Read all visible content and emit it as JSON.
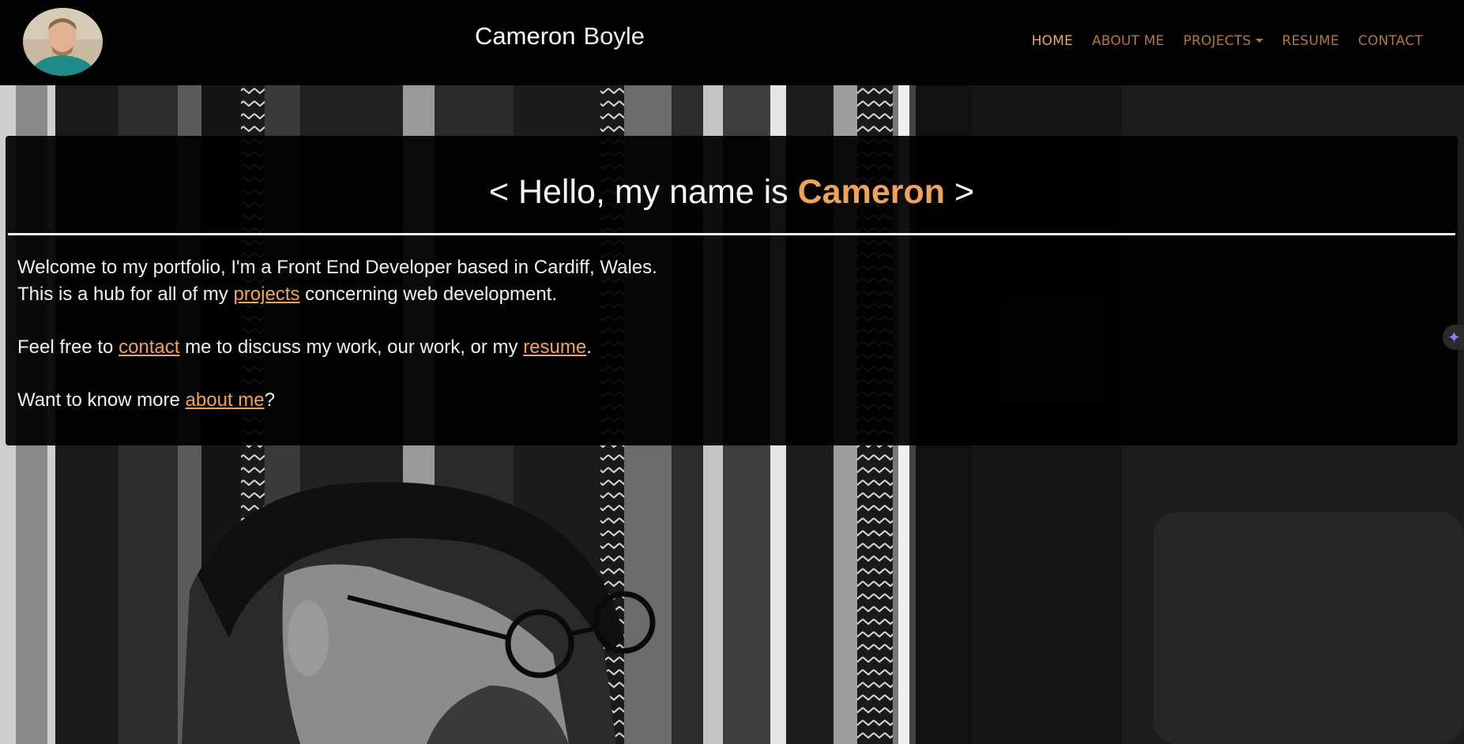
{
  "header": {
    "first_name": "Cameron",
    "last_name": "Boyle"
  },
  "nav": {
    "items": [
      {
        "label": "HOME",
        "active": true
      },
      {
        "label": "ABOUT ME"
      },
      {
        "label": "PROJECTS",
        "dropdown": true
      },
      {
        "label": "RESUME"
      },
      {
        "label": "CONTACT"
      }
    ]
  },
  "intro": {
    "heading_prefix": "< Hello, my name is ",
    "heading_name": "Cameron",
    "heading_suffix": " >",
    "line1": "Welcome to my portfolio, I'm a Front End Developer based in Cardiff, Wales.",
    "line2_pre": "This is a hub for all of my ",
    "line2_link": "projects",
    "line2_post": " concerning web development.",
    "line3_pre": "Feel free to ",
    "line3_link1": "contact",
    "line3_mid": " me to discuss my work, our work, or my ",
    "line3_link2": "resume",
    "line3_post": ".",
    "line4_pre": "Want to know more ",
    "line4_link": "about me",
    "line4_post": "?"
  },
  "colors": {
    "accent": "#f0a355",
    "nav_link": "#b3753e",
    "navbar_bg": "#020202"
  },
  "icons": {
    "avatar": "profile-photo",
    "sparkle": "sparkle-icon"
  }
}
